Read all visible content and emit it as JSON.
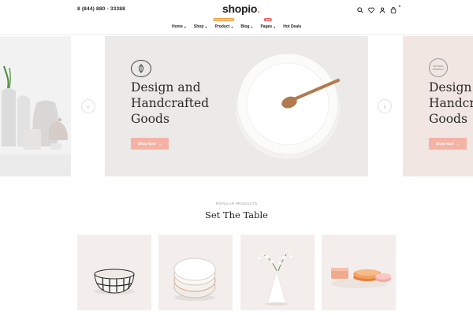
{
  "header": {
    "phone": "8 (844) 880 - 33388",
    "logo_main": "shopio",
    "logo_dot": ".",
    "cart_count": "0",
    "nav": [
      {
        "label": "Home",
        "dropdown": true,
        "badge": ""
      },
      {
        "label": "Shop",
        "dropdown": true,
        "badge": ""
      },
      {
        "label": "Product",
        "dropdown": true,
        "badge": "SALE HOT ITEMS"
      },
      {
        "label": "Blog",
        "dropdown": true,
        "badge": ""
      },
      {
        "label": "Pages",
        "dropdown": true,
        "badge": "NEW"
      },
      {
        "label": "Hot Deals",
        "dropdown": false,
        "badge": ""
      }
    ]
  },
  "hero": {
    "main": {
      "title_lines": [
        "Design and",
        "Handcrafted",
        "Goods"
      ],
      "button": "Shop Now"
    },
    "next": {
      "title_lines": [
        "Design",
        "Handcr",
        "Goods"
      ],
      "button": "Shop Now",
      "badge_lines": [
        "NATURAL",
        "PRODUCT"
      ]
    },
    "prev_arrow": "‹",
    "next_arrow": "›"
  },
  "section": {
    "subtitle": "POPULAR PRODUCTS",
    "title": "Set The Table"
  },
  "colors": {
    "accent": "#f5b3a6",
    "logo_dot": "#f28c6a",
    "hero_bg": "#ebeae9",
    "hero_right_bg": "#f1e6e2",
    "card_bg": "#f3eeeb"
  },
  "icons": [
    "search-icon",
    "heart-icon",
    "user-icon",
    "cart-icon",
    "leaf-icon",
    "arrow-right-icon"
  ]
}
